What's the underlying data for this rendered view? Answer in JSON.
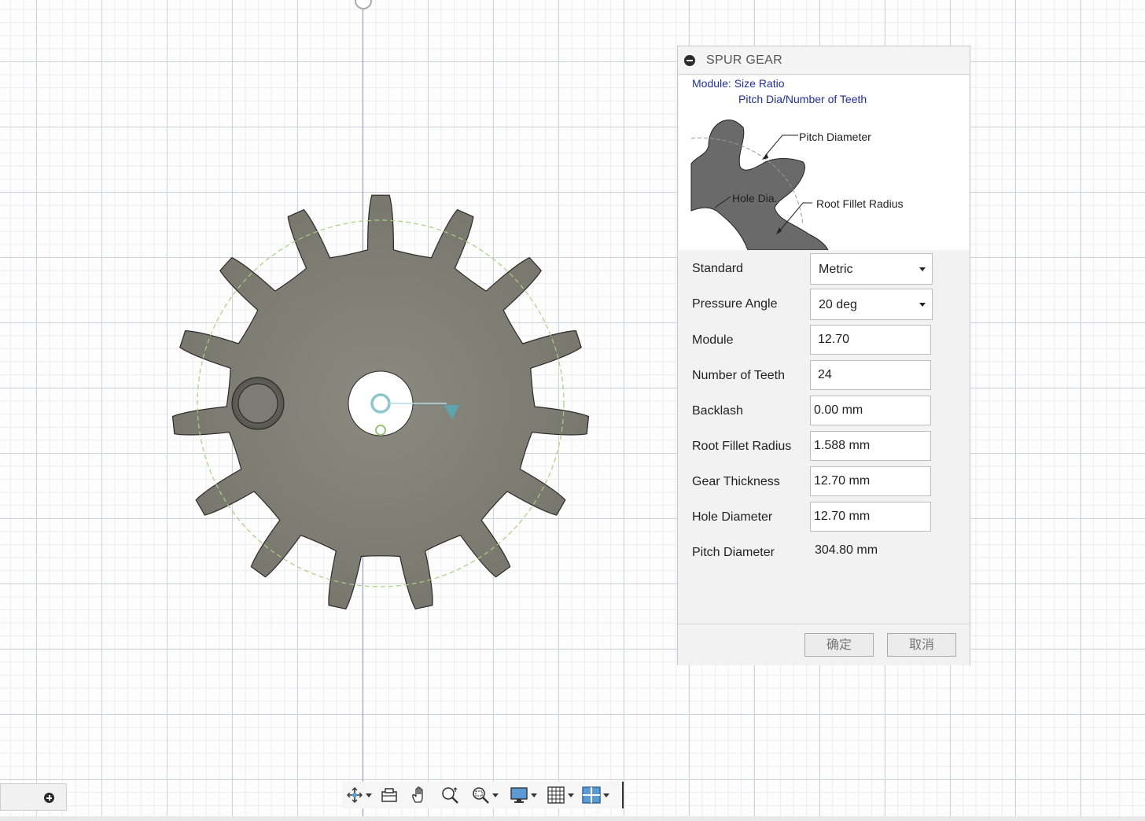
{
  "dialog": {
    "title": "SPUR GEAR",
    "help_line1": "Module: Size Ratio",
    "help_line2": "Pitch Dia/Number of Teeth",
    "diagram_labels": {
      "pitch_diameter": "Pitch Diameter",
      "hole_dia": "Hole Dia.",
      "root_fillet_radius": "Root Fillet Radius"
    },
    "fields": {
      "standard": {
        "label": "Standard",
        "value": "Metric"
      },
      "pressure_angle": {
        "label": "Pressure Angle",
        "value": "20 deg"
      },
      "module": {
        "label": "Module",
        "value": "12.70"
      },
      "number_of_teeth": {
        "label": "Number of Teeth",
        "value": "24"
      },
      "backlash": {
        "label": "Backlash",
        "value": "0.00 mm"
      },
      "root_fillet_radius": {
        "label": "Root Fillet Radius",
        "value": "1.588 mm"
      },
      "gear_thickness": {
        "label": "Gear Thickness",
        "value": "12.70 mm"
      },
      "hole_diameter": {
        "label": "Hole Diameter",
        "value": "12.70 mm"
      },
      "pitch_diameter": {
        "label": "Pitch Diameter",
        "value": "304.80 mm"
      }
    },
    "ok_label": "确定",
    "cancel_label": "取消"
  },
  "canvas": {
    "gear_teeth_shown": 15,
    "gear_color": "#7f7f74",
    "pitch_circle_color": "#a9cf7f",
    "axis_color": "#8c8ce0"
  },
  "toolbar": {
    "items": [
      "orbit-icon",
      "look-at-icon",
      "pan-icon",
      "zoom-icon",
      "fit-icon",
      "display-settings-icon",
      "grid-settings-icon",
      "viewports-icon"
    ]
  }
}
